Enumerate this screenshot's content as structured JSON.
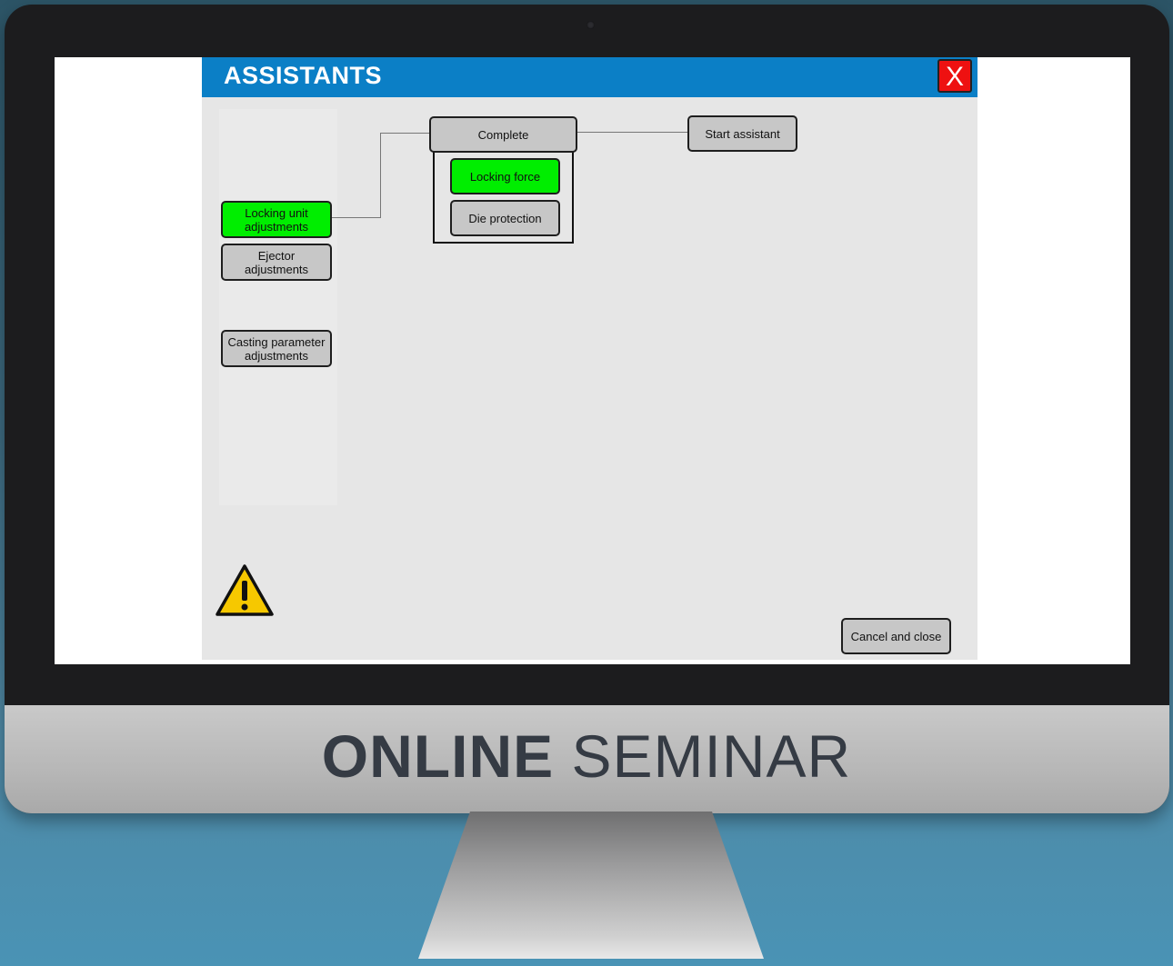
{
  "dialog": {
    "title": "ASSISTANTS",
    "close_label": "X"
  },
  "sidebar": {
    "items": [
      {
        "label": "Locking unit\nadjustments",
        "active": true
      },
      {
        "label": "Ejector\nadjustments",
        "active": false
      },
      {
        "label": "Casting parameter\nadjustments",
        "active": false
      }
    ]
  },
  "flow": {
    "complete_label": "Complete",
    "sub_items": [
      {
        "label": "Locking force",
        "active": true
      },
      {
        "label": "Die protection",
        "active": false
      }
    ],
    "start_label": "Start assistant"
  },
  "footer": {
    "cancel_label": "Cancel and close"
  },
  "monitor": {
    "brand_bold": "ONLINE",
    "brand_light": "SEMINAR"
  },
  "colors": {
    "title_bar": "#0b7fc6",
    "active": "#00ee00",
    "inactive": "#c7c7c7",
    "close": "#ee1111",
    "warning": "#f6c800"
  },
  "icons": [
    "warning-icon",
    "close-icon"
  ]
}
